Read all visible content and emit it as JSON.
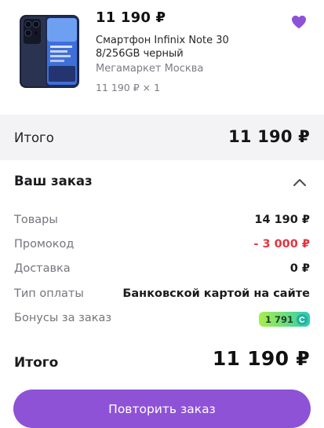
{
  "product": {
    "price": "11 190 ₽",
    "name": "Смартфон Infinix Note 30 8/256GB черный",
    "seller": "Мегамаркет Москва",
    "quantity": "11 190 ₽ × 1",
    "favorite_icon": "heart-icon",
    "image_icon": "smartphone-image"
  },
  "total_bar": {
    "label": "Итого",
    "value": "11 190 ₽"
  },
  "order": {
    "title": "Ваш заказ",
    "toggle_icon": "chevron-up-icon",
    "rows": [
      {
        "label": "Товары",
        "value": "14 190 ₽"
      },
      {
        "label": "Промокод",
        "value": "- 3 000 ₽"
      },
      {
        "label": "Доставка",
        "value": "0 ₽"
      },
      {
        "label": "Тип оплаты",
        "value": "Банковской картой на сайте"
      },
      {
        "label": "Бонусы за заказ",
        "value": "1 791"
      }
    ],
    "final_label": "Итого",
    "final_value": "11 190 ₽"
  },
  "actions": {
    "repeat_label": "Повторить заказ"
  },
  "colors": {
    "accent": "#8e52d6",
    "discount": "#e2353f",
    "bar_bg": "#f3f3f6",
    "bonus_gradient": [
      "#a8ee4a",
      "#2fc7b4"
    ]
  }
}
